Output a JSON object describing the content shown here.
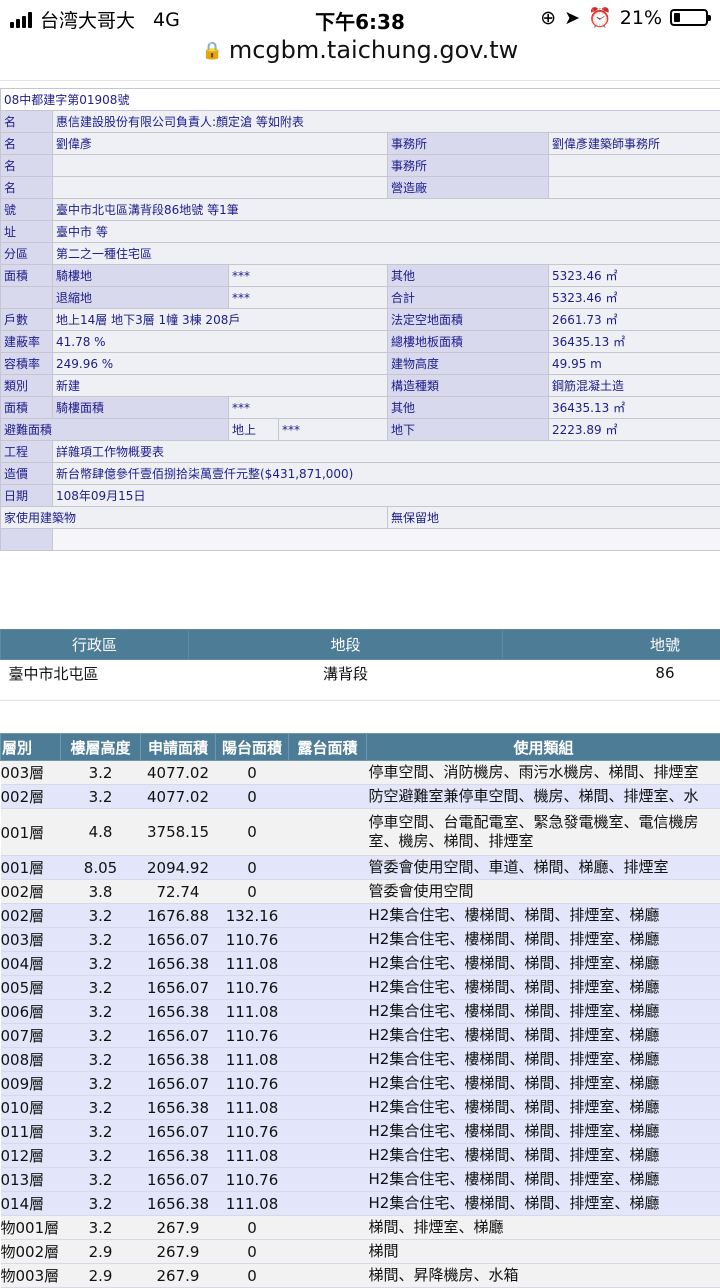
{
  "status": {
    "carrier": "台湾大哥大",
    "network": "4G",
    "time": "下午6:38",
    "battery": "21%",
    "battery_level": 0.21
  },
  "browser": {
    "url": "mcgbm.taichung.gov.tw"
  },
  "permit": {
    "number": "08中都建字第01908號",
    "rows": [
      {
        "label": "名",
        "value": "惠信建設股份有限公司負責人:顏定滄 等如附表"
      },
      {
        "label": "名",
        "value": "劉偉彥",
        "label2": "事務所",
        "value2": "劉偉彥建築師事務所"
      },
      {
        "label": "名",
        "value": "",
        "label2": "事務所",
        "value2": ""
      },
      {
        "label": "名",
        "value": "",
        "label2": "營造廠",
        "value2": ""
      },
      {
        "label": "號",
        "value": "臺中市北屯區溝背段86地號 等1筆"
      },
      {
        "label": "址",
        "value": "臺中市 等"
      },
      {
        "label": "分區",
        "value": "第二之一種住宅區"
      },
      {
        "label": "面積",
        "value": "騎樓地",
        "mid": "***",
        "label2": "其他",
        "value2": "5323.46 ㎡"
      },
      {
        "label": "",
        "value": "退縮地",
        "mid": "***",
        "label2": "合計",
        "value2": "5323.46 ㎡"
      },
      {
        "label": "戶數",
        "value": "地上14層 地下3層 1幢 3棟 208戶",
        "label2": "法定空地面積",
        "value2": "2661.73 ㎡"
      },
      {
        "label": "建蔽率",
        "value": "41.78 %",
        "label2": "總樓地板面積",
        "value2": "36435.13 ㎡"
      },
      {
        "label": "容積率",
        "value": "249.96 %",
        "label2": "建物高度",
        "value2": "49.95 m"
      },
      {
        "label": "類別",
        "value": "新建",
        "label2": "構造種類",
        "value2": "鋼筋混凝土造"
      },
      {
        "label": "面積",
        "value": "騎樓面積",
        "mid": "***",
        "label2": "其他",
        "value2": "36435.13 ㎡"
      },
      {
        "label": "避難面積",
        "sub": "地上",
        "mid": "***",
        "label2": "地下",
        "value2": "2223.89 ㎡"
      },
      {
        "label": "工程",
        "value": "詳雜項工作物概要表"
      },
      {
        "label": "造價",
        "value": "新台幣肆億參仟壹佰捌拾柒萬壹仟元整($431,871,000)"
      },
      {
        "label": "日期",
        "value": "108年09月15日"
      },
      {
        "label": "家使用建築物",
        "label2": "無保留地"
      }
    ]
  },
  "lot_table": {
    "headers": [
      "行政區",
      "地段",
      "地號"
    ],
    "row": [
      "臺中市北屯區",
      "溝背段",
      "86"
    ]
  },
  "floor_table": {
    "headers": [
      "層別",
      "樓層高度",
      "申請面積",
      "陽台面積",
      "露台面積",
      "使用類組"
    ],
    "rows": [
      [
        "003層",
        "3.2",
        "4077.02",
        "0",
        "",
        "停車空間、消防機房、雨污水機房、梯間、排煙室"
      ],
      [
        "002層",
        "3.2",
        "4077.02",
        "0",
        "",
        "防空避難室兼停車空間、機房、梯間、排煙室、水"
      ],
      [
        "001層",
        "4.8",
        "3758.15",
        "0",
        "",
        "停車空間、台電配電室、緊急發電機室、電信機房室、機房、梯間、排煙室"
      ],
      [
        "001層",
        "8.05",
        "2094.92",
        "0",
        "",
        "管委會使用空間、車道、梯間、梯廳、排煙室"
      ],
      [
        "002層",
        "3.8",
        "72.74",
        "0",
        "",
        "管委會使用空間"
      ],
      [
        "002層",
        "3.2",
        "1676.88",
        "132.16",
        "",
        "H2集合住宅、樓梯間、梯間、排煙室、梯廳"
      ],
      [
        "003層",
        "3.2",
        "1656.07",
        "110.76",
        "",
        "H2集合住宅、樓梯間、梯間、排煙室、梯廳"
      ],
      [
        "004層",
        "3.2",
        "1656.38",
        "111.08",
        "",
        "H2集合住宅、樓梯間、梯間、排煙室、梯廳"
      ],
      [
        "005層",
        "3.2",
        "1656.07",
        "110.76",
        "",
        "H2集合住宅、樓梯間、梯間、排煙室、梯廳"
      ],
      [
        "006層",
        "3.2",
        "1656.38",
        "111.08",
        "",
        "H2集合住宅、樓梯間、梯間、排煙室、梯廳"
      ],
      [
        "007層",
        "3.2",
        "1656.07",
        "110.76",
        "",
        "H2集合住宅、樓梯間、梯間、排煙室、梯廳"
      ],
      [
        "008層",
        "3.2",
        "1656.38",
        "111.08",
        "",
        "H2集合住宅、樓梯間、梯間、排煙室、梯廳"
      ],
      [
        "009層",
        "3.2",
        "1656.07",
        "110.76",
        "",
        "H2集合住宅、樓梯間、梯間、排煙室、梯廳"
      ],
      [
        "010層",
        "3.2",
        "1656.38",
        "111.08",
        "",
        "H2集合住宅、樓梯間、梯間、排煙室、梯廳"
      ],
      [
        "011層",
        "3.2",
        "1656.07",
        "110.76",
        "",
        "H2集合住宅、樓梯間、梯間、排煙室、梯廳"
      ],
      [
        "012層",
        "3.2",
        "1656.38",
        "111.08",
        "",
        "H2集合住宅、樓梯間、梯間、排煙室、梯廳"
      ],
      [
        "013層",
        "3.2",
        "1656.07",
        "110.76",
        "",
        "H2集合住宅、樓梯間、梯間、排煙室、梯廳"
      ],
      [
        "014層",
        "3.2",
        "1656.38",
        "111.08",
        "",
        "H2集合住宅、樓梯間、梯間、排煙室、梯廳"
      ],
      [
        "物001層",
        "3.2",
        "267.9",
        "0",
        "",
        "梯間、排煙室、梯廳"
      ],
      [
        "物002層",
        "2.9",
        "267.9",
        "0",
        "",
        "梯間"
      ],
      [
        "物003層",
        "2.9",
        "267.9",
        "0",
        "",
        "梯間、昇降機房、水箱"
      ]
    ]
  }
}
